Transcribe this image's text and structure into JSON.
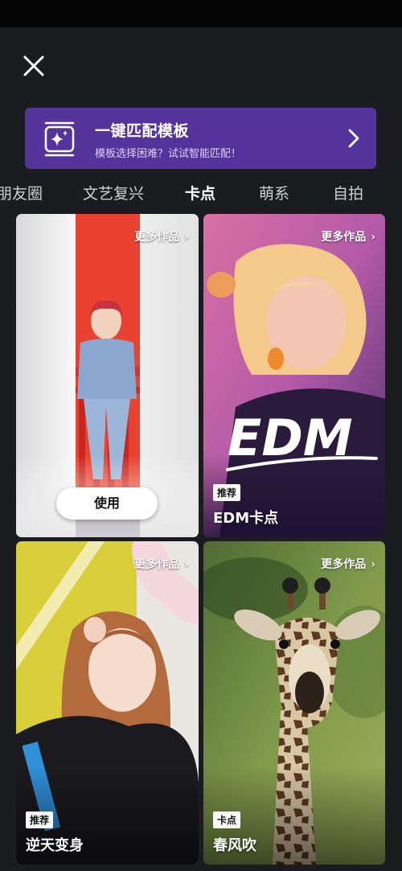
{
  "header": {
    "close_icon": "close-icon"
  },
  "match_banner": {
    "title": "一键匹配模板",
    "subtitle": "模板选择困难？试试智能匹配！",
    "icon": "sparkle-frame-icon",
    "background": "#54349a"
  },
  "tabs": [
    {
      "label": "朋友圈",
      "active": false
    },
    {
      "label": "文艺复兴",
      "active": false
    },
    {
      "label": "卡点",
      "active": true
    },
    {
      "label": "萌系",
      "active": false
    },
    {
      "label": "自拍",
      "active": false
    }
  ],
  "cards": [
    {
      "more_label": "更多作品",
      "use_label": "使用",
      "badge": "",
      "title": ""
    },
    {
      "more_label": "更多作品",
      "badge": "推荐",
      "title": "EDM卡点",
      "overlay_text": "EDM"
    },
    {
      "more_label": "更多作品",
      "badge": "推荐",
      "title": "逆天变身"
    },
    {
      "more_label": "更多作品",
      "badge": "卡点",
      "title": "春风吹"
    }
  ]
}
